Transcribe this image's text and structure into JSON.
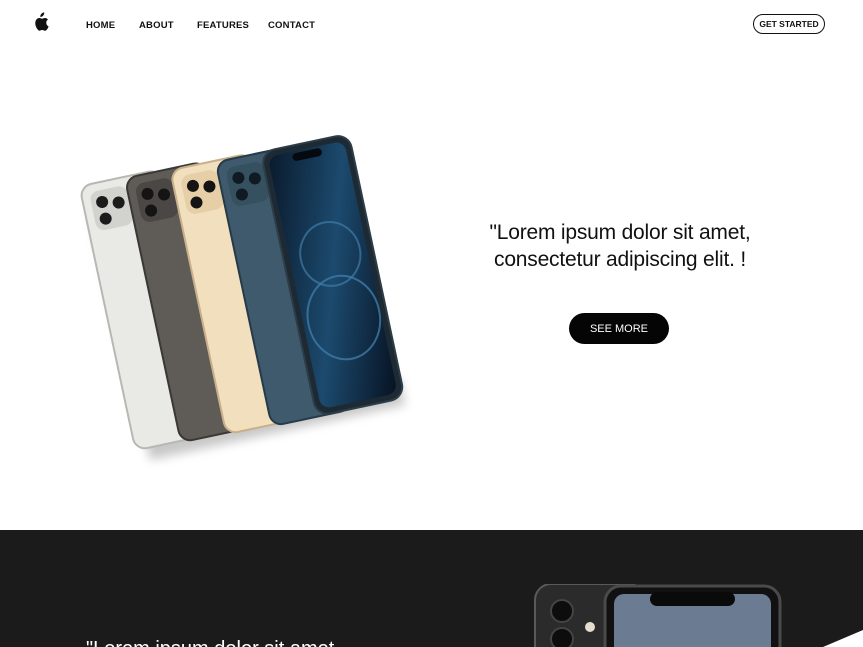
{
  "nav": {
    "logo_icon": "apple-logo-icon",
    "links": [
      "HOME",
      "ABOUT",
      "FEATURES",
      "CONTACT"
    ],
    "cta_label": "GET STARTED"
  },
  "hero": {
    "quote": "\"Lorem ipsum dolor sit amet, consectetur adipiscing elit.  !",
    "button_label": "SEE MORE",
    "image": "iphone-lineup-image"
  },
  "dark_section": {
    "background": "#1b1b1b",
    "quote_partial": "\"Lorem ipsum dolor sit amet,",
    "image": "iphone-front-back-image"
  }
}
